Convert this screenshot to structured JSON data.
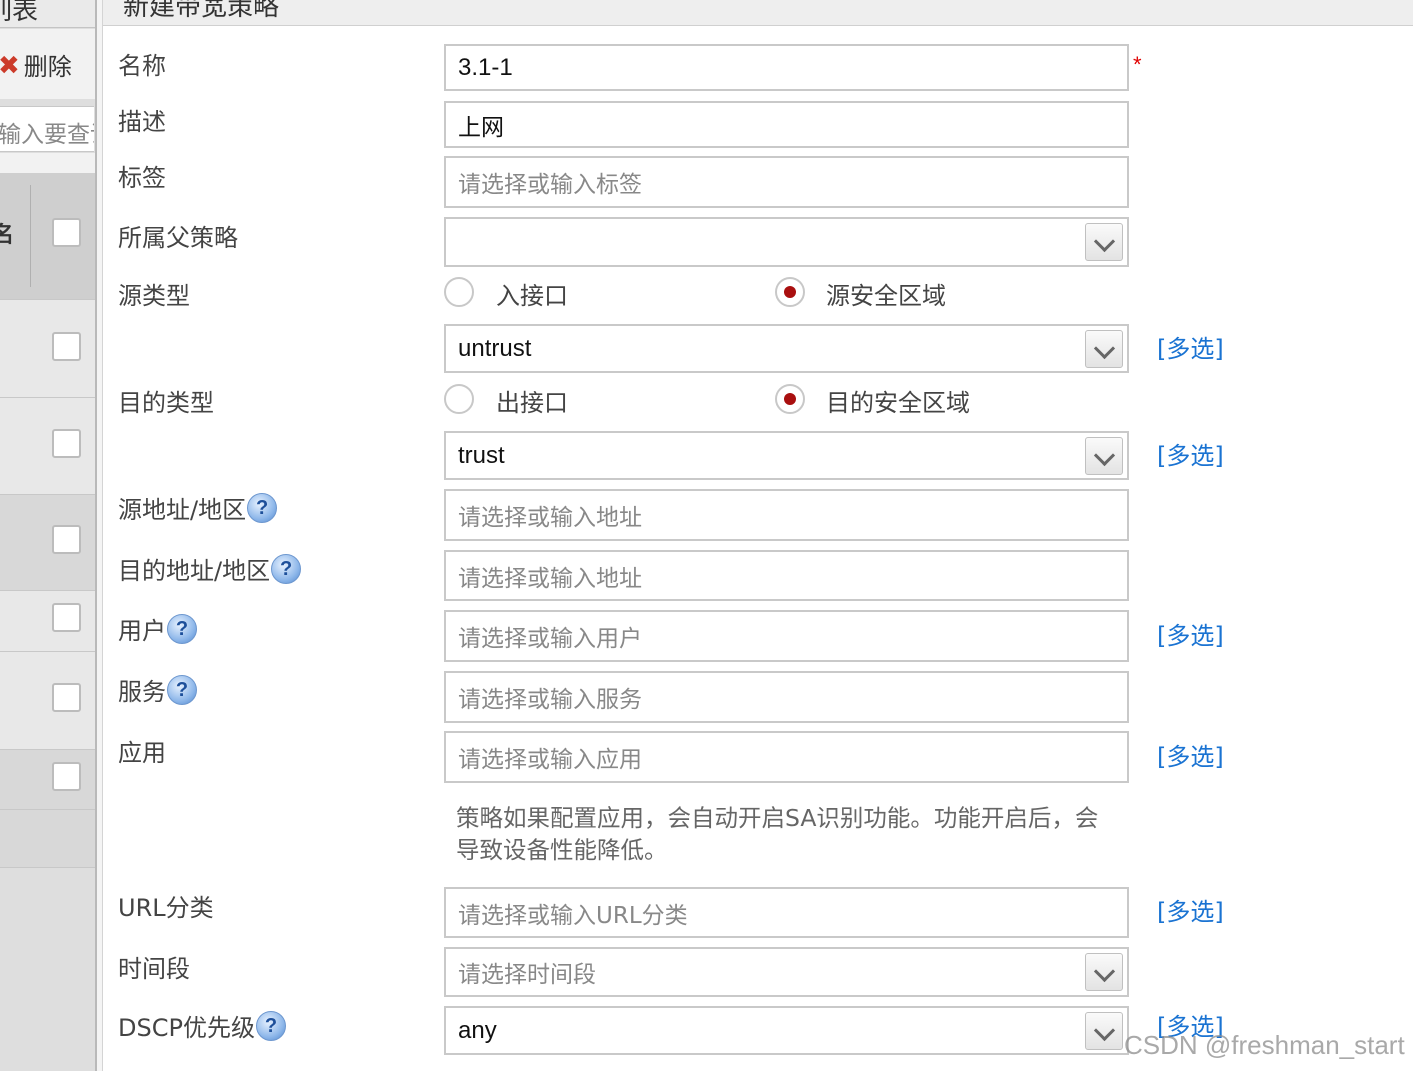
{
  "left_panel": {
    "title": "列表",
    "delete_label": "删除",
    "search_placeholder": "输入要查询"
  },
  "dialog": {
    "title": "新建带宽策略"
  },
  "form": {
    "name": {
      "label": "名称",
      "value": "3.1-1",
      "required_mark": "*"
    },
    "description": {
      "label": "描述",
      "value": "上网"
    },
    "tag": {
      "label": "标签",
      "placeholder": "请选择或输入标签"
    },
    "parent_policy": {
      "label": "所属父策略",
      "value": ""
    },
    "source_type": {
      "label": "源类型",
      "options": [
        "入接口",
        "源安全区域"
      ],
      "selected": "源安全区域",
      "zone_value": "untrust",
      "multi_label": "[多选]"
    },
    "dest_type": {
      "label": "目的类型",
      "options": [
        "出接口",
        "目的安全区域"
      ],
      "selected": "目的安全区域",
      "zone_value": "trust",
      "multi_label": "[多选]"
    },
    "source_address": {
      "label": "源地址/地区",
      "placeholder": "请选择或输入地址"
    },
    "dest_address": {
      "label": "目的地址/地区",
      "placeholder": "请选择或输入地址"
    },
    "user": {
      "label": "用户",
      "placeholder": "请选择或输入用户",
      "multi_label": "[多选]"
    },
    "service": {
      "label": "服务",
      "placeholder": "请选择或输入服务"
    },
    "application": {
      "label": "应用",
      "placeholder": "请选择或输入应用",
      "multi_label": "[多选]",
      "note": "策略如果配置应用，会自动开启SA识别功能。功能开启后，会导致设备性能降低。"
    },
    "url_category": {
      "label": "URL分类",
      "placeholder": "请选择或输入URL分类",
      "multi_label": "[多选]"
    },
    "time_range": {
      "label": "时间段",
      "placeholder": "请选择时间段"
    },
    "dscp": {
      "label": "DSCP优先级",
      "value": "any",
      "multi_label": "[多选]"
    },
    "help_glyph": "?"
  },
  "watermark": "CSDN @freshman_start",
  "colors": {
    "link": "#1a73d2",
    "required": "#e00000",
    "radio_dot": "#a90f0f"
  }
}
